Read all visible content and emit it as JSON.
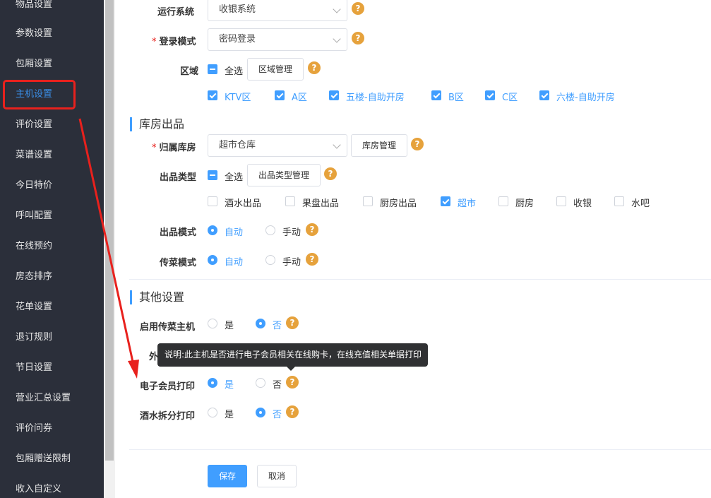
{
  "sidebar": {
    "items": [
      {
        "label": "物品设置"
      },
      {
        "label": "参数设置"
      },
      {
        "label": "包厢设置"
      },
      {
        "label": "主机设置"
      },
      {
        "label": "评价设置"
      },
      {
        "label": "菜谱设置"
      },
      {
        "label": "今日特价"
      },
      {
        "label": "呼叫配置"
      },
      {
        "label": "在线预约"
      },
      {
        "label": "房态排序"
      },
      {
        "label": "花单设置"
      },
      {
        "label": "退订规则"
      },
      {
        "label": "节日设置"
      },
      {
        "label": "营业汇总设置"
      },
      {
        "label": "评价问券"
      },
      {
        "label": "包厢赠送限制"
      },
      {
        "label": "收入自定义"
      }
    ],
    "active_index": 3
  },
  "form": {
    "run_system": {
      "label": "运行系统",
      "value": "收银系统"
    },
    "login_mode": {
      "required_mark": "*",
      "label": "登录模式",
      "value": "密码登录"
    },
    "area": {
      "label": "区域",
      "select_all": "全选",
      "manage_button": "区域管理",
      "options": [
        "KTV区",
        "A区",
        "五楼-自助开房",
        "B区",
        "C区",
        "六楼-自助开房"
      ]
    }
  },
  "warehouse": {
    "section_title": "库房出品",
    "belong": {
      "required_mark": "*",
      "label": "归属库房",
      "value": "超市仓库",
      "manage_button": "库房管理"
    },
    "type": {
      "label": "出品类型",
      "select_all": "全选",
      "manage_button": "出品类型管理",
      "options": [
        "酒水出品",
        "果盘出品",
        "厨房出品",
        "超市",
        "厨房",
        "收银",
        "水吧"
      ]
    },
    "output_mode": {
      "label": "出品模式",
      "auto": "自动",
      "manual": "手动"
    },
    "serve_mode": {
      "label": "传菜模式",
      "auto": "自动",
      "manual": "手动"
    }
  },
  "other": {
    "section_title": "其他设置",
    "serve_host": {
      "label": "启用传菜主机",
      "yes": "是",
      "no": "否"
    },
    "hidden_row_label": "外",
    "e_member_print": {
      "label": "电子会员打印",
      "yes": "是",
      "no": "否"
    },
    "wine_split_print": {
      "label": "酒水拆分打印",
      "yes": "是",
      "no": "否"
    },
    "tooltip": "说明:此主机是否进行电子会员相关在线购卡，在线充值相关单据打印"
  },
  "actions": {
    "save": "保存",
    "cancel": "取消"
  },
  "help_glyph": "?",
  "colors": {
    "sidebar_bg": "#2b2f3a",
    "primary": "#409eff",
    "help": "#e6a23c",
    "highlight": "#e8211d"
  }
}
